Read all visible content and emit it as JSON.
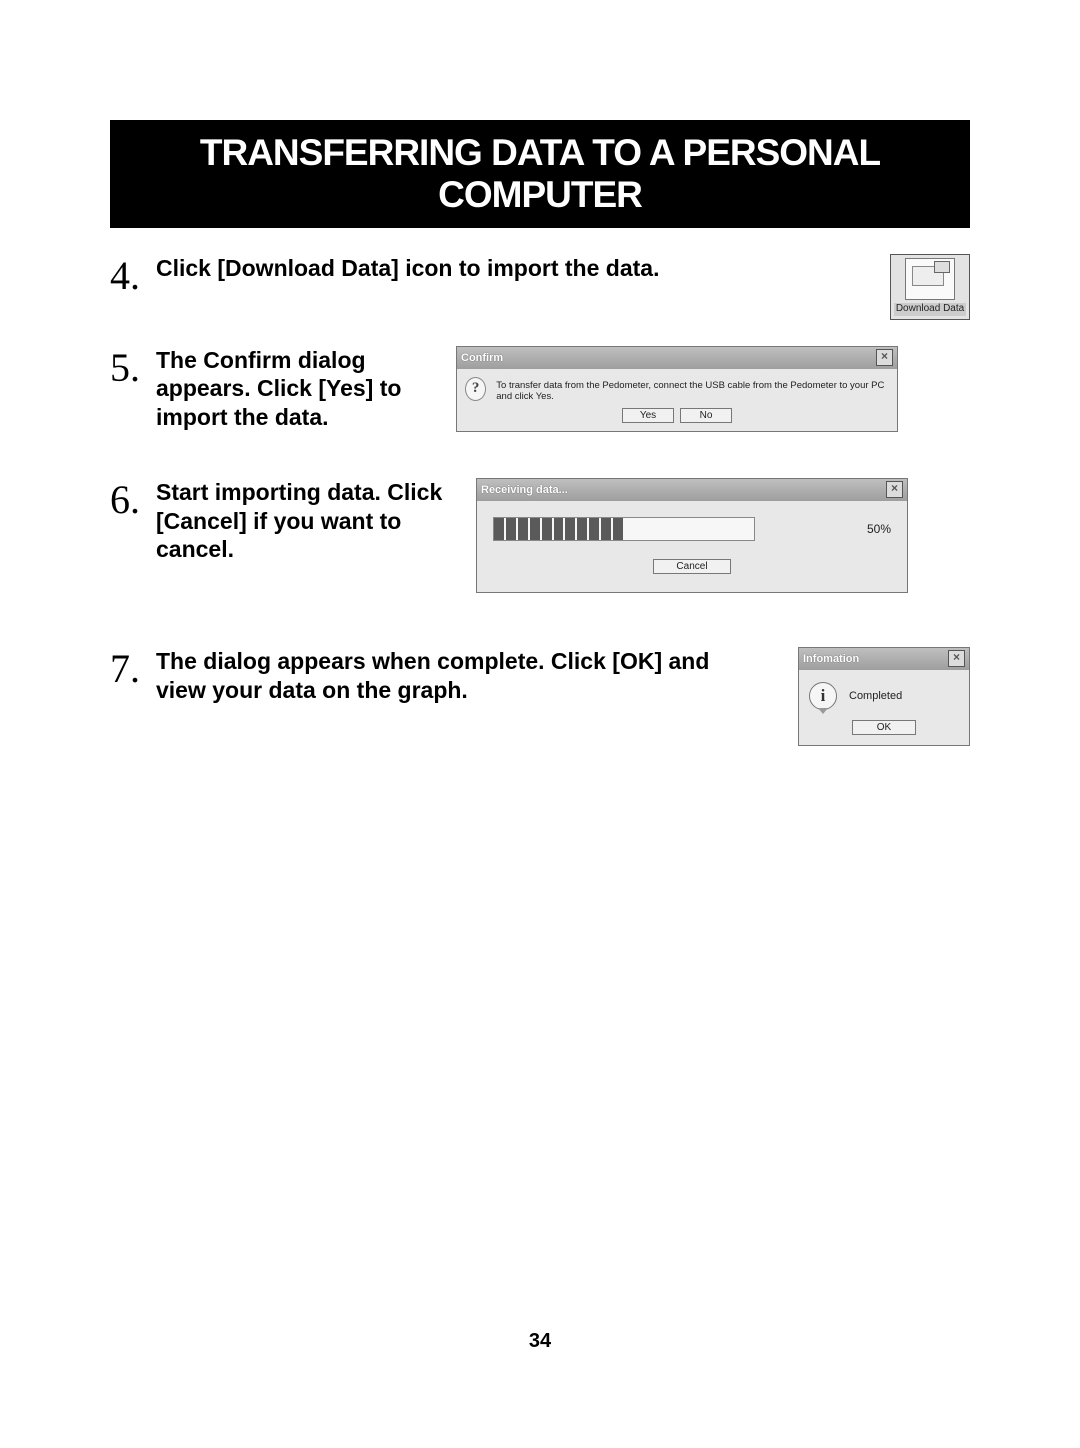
{
  "banner": "TRANSFERRING DATA TO A PERSONAL COMPUTER",
  "page_number": "34",
  "steps": {
    "s4": {
      "num": "4.",
      "text": "Click [Download Data] icon to import the data."
    },
    "s5": {
      "num": "5.",
      "text": "The Confirm dialog appears. Click [Yes] to import the data."
    },
    "s6": {
      "num": "6.",
      "text": "Start importing data. Click [Cancel] if you want to cancel."
    },
    "s7": {
      "num": "7.",
      "text": "The dialog appears when complete. Click [OK] and view your data on the graph."
    }
  },
  "download_icon": {
    "label": "Download Data"
  },
  "confirm_dialog": {
    "title": "Confirm",
    "message": "To transfer data from the Pedometer, connect the USB cable from the Pedometer to your PC and click Yes.",
    "yes": "Yes",
    "no": "No",
    "icon": "question-icon"
  },
  "receiving_dialog": {
    "title": "Receiving data...",
    "percent": "50%",
    "cancel": "Cancel",
    "progress_value": 50
  },
  "info_dialog": {
    "title": "Infomation",
    "message": "Completed",
    "ok": "OK",
    "icon": "info-icon"
  }
}
